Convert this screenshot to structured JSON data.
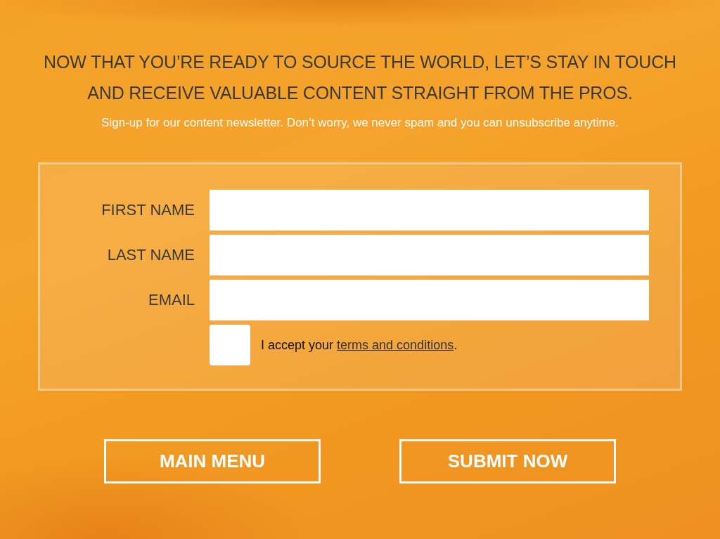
{
  "heading": "NOW THAT YOU’RE READY TO SOURCE THE WORLD, LET’S STAY IN TOUCH AND RECEIVE VALUABLE CONTENT STRAIGHT FROM THE PROS.",
  "subheading": "Sign-up for our content newsletter. Don’t worry, we never spam and you can unsubscribe anytime.",
  "form": {
    "fields": [
      {
        "label": "FIRST NAME"
      },
      {
        "label": "LAST NAME"
      },
      {
        "label": "EMAIL"
      }
    ],
    "consent": {
      "checked": false,
      "text_before": "I accept your ",
      "link": "terms and conditions",
      "text_after": "."
    }
  },
  "buttons": [
    {
      "label": "MAIN MENU"
    },
    {
      "label": "SUBMIT NOW"
    }
  ]
}
